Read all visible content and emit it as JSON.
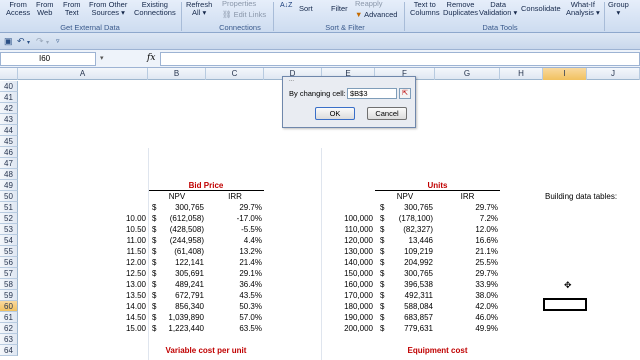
{
  "ribbon": {
    "from_access": "From\nAccess",
    "from_web": "From\nWeb",
    "from_text": "From\nText",
    "from_other": "From Other\nSources ▾",
    "existing_connections": "Existing\nConnections",
    "refresh_all": "Refresh\nAll ▾",
    "properties": "Properties",
    "edit_links": "Edit Links",
    "sort_az": "A↓Z",
    "sort": "Sort",
    "filter": "Filter",
    "reapply": "Reapply",
    "advanced": "Advanced",
    "text_to_columns": "Text to\nColumns",
    "remove_duplicates": "Remove\nDuplicates",
    "data_validation": "Data\nValidation ▾",
    "consolidate": "Consolidate",
    "what_if": "What-If\nAnalysis ▾",
    "group": "Group\n▾",
    "group_labels": {
      "external": "Get External Data",
      "connections": "Connections",
      "sortfilter": "Sort & Filter",
      "datatools": "Data Tools"
    }
  },
  "namebox": "I60",
  "columns": [
    "A",
    "B",
    "C",
    "D",
    "E",
    "F",
    "G",
    "H",
    "I",
    "J"
  ],
  "rows": [
    "40",
    "41",
    "42",
    "43",
    "44",
    "45",
    "46",
    "47",
    "48",
    "49",
    "50",
    "51",
    "52",
    "53",
    "54",
    "55",
    "56",
    "57",
    "58",
    "59",
    "60",
    "61",
    "62",
    "63",
    "64"
  ],
  "selected_row": "60",
  "selected_col": "I",
  "bid": {
    "title": "Bid Price",
    "npv_header": "NPV",
    "irr_header": "IRR",
    "rows": [
      {
        "price": "",
        "npv": "300,765",
        "irr": "29.7%"
      },
      {
        "price": "10.00",
        "npv": "(612,058)",
        "irr": "-17.0%"
      },
      {
        "price": "10.50",
        "npv": "(428,508)",
        "irr": "-5.5%"
      },
      {
        "price": "11.00",
        "npv": "(244,958)",
        "irr": "4.4%"
      },
      {
        "price": "11.50",
        "npv": "(61,408)",
        "irr": "13.2%"
      },
      {
        "price": "12.00",
        "npv": "122,141",
        "irr": "21.4%"
      },
      {
        "price": "12.50",
        "npv": "305,691",
        "irr": "29.1%"
      },
      {
        "price": "13.00",
        "npv": "489,241",
        "irr": "36.4%"
      },
      {
        "price": "13.50",
        "npv": "672,791",
        "irr": "43.5%"
      },
      {
        "price": "14.00",
        "npv": "856,340",
        "irr": "50.3%"
      },
      {
        "price": "14.50",
        "npv": "1,039,890",
        "irr": "57.0%"
      },
      {
        "price": "15.00",
        "npv": "1,223,440",
        "irr": "63.5%"
      }
    ],
    "next_title": "Variable cost per unit"
  },
  "units": {
    "title": "Units",
    "npv_header": "NPV",
    "irr_header": "IRR",
    "rows": [
      {
        "units": "",
        "npv": "300,765",
        "irr": "29.7%"
      },
      {
        "units": "100,000",
        "npv": "(178,100)",
        "irr": "7.2%"
      },
      {
        "units": "110,000",
        "npv": "(82,327)",
        "irr": "12.0%"
      },
      {
        "units": "120,000",
        "npv": "13,446",
        "irr": "16.6%"
      },
      {
        "units": "130,000",
        "npv": "109,219",
        "irr": "21.1%"
      },
      {
        "units": "140,000",
        "npv": "204,992",
        "irr": "25.5%"
      },
      {
        "units": "150,000",
        "npv": "300,765",
        "irr": "29.7%"
      },
      {
        "units": "160,000",
        "npv": "396,538",
        "irr": "33.9%"
      },
      {
        "units": "170,000",
        "npv": "492,311",
        "irr": "38.0%"
      },
      {
        "units": "180,000",
        "npv": "588,084",
        "irr": "42.0%"
      },
      {
        "units": "190,000",
        "npv": "683,857",
        "irr": "46.0%"
      },
      {
        "units": "200,000",
        "npv": "779,631",
        "irr": "49.9%"
      }
    ],
    "next_title": "Equipment cost"
  },
  "currency_symbol": "$",
  "note": "Building data tables:",
  "dialog": {
    "partial_label": "...",
    "changing_label": "By changing cell:",
    "changing_value": "$B$3",
    "ok": "OK",
    "cancel": "Cancel"
  }
}
